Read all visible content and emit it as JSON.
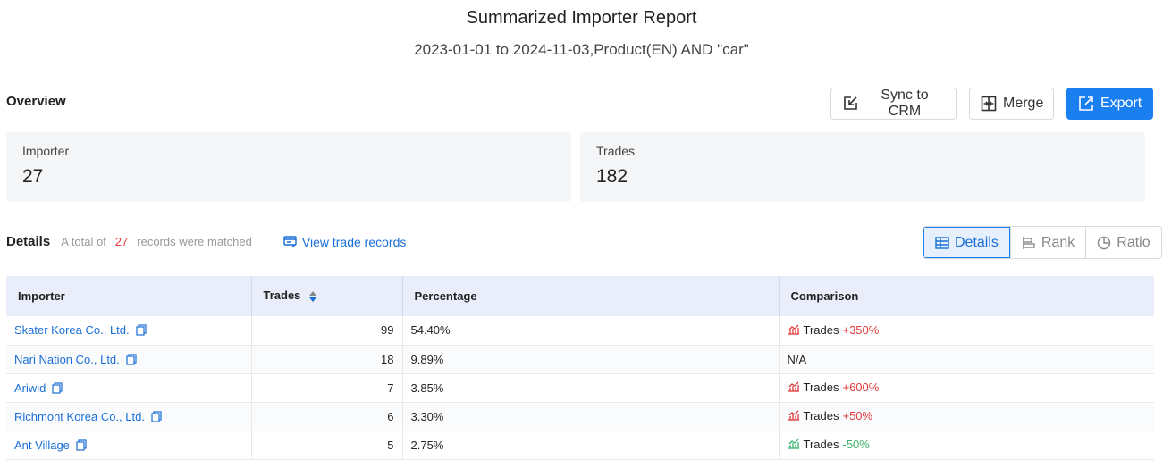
{
  "report": {
    "title": "Summarized Importer Report",
    "subtitle": "2023-01-01 to 2024-11-03,Product(EN) AND \"car\""
  },
  "overview": {
    "label": "Overview",
    "sync_label": "Sync to CRM",
    "merge_label": "Merge",
    "export_label": "Export",
    "accent_color": "#1a7ff0"
  },
  "stats": {
    "importer_label": "Importer",
    "importer_value": "27",
    "trades_label": "Trades",
    "trades_value": "182"
  },
  "details": {
    "label": "Details",
    "total_prefix": "A total of",
    "count": "27",
    "total_suffix": "records were matched",
    "view_link": "View trade records",
    "views": [
      "Details",
      "Rank",
      "Ratio"
    ],
    "active_view": "Details"
  },
  "table": {
    "headers": {
      "importer": "Importer",
      "trades": "Trades",
      "percentage": "Percentage",
      "comparison": "Comparison"
    },
    "rows": [
      {
        "importer": "Skater Korea Co., Ltd.",
        "trades": "99",
        "percentage": "54.40%",
        "cmp_label": "Trades",
        "cmp_value": "+350%",
        "trend": "up"
      },
      {
        "importer": "Nari Nation Co., Ltd.",
        "trades": "18",
        "percentage": "9.89%",
        "cmp_label": "",
        "cmp_value": "N/A",
        "trend": "none"
      },
      {
        "importer": "Ariwid",
        "trades": "7",
        "percentage": "3.85%",
        "cmp_label": "Trades",
        "cmp_value": "+600%",
        "trend": "up"
      },
      {
        "importer": "Richmont Korea Co., Ltd.",
        "trades": "6",
        "percentage": "3.30%",
        "cmp_label": "Trades",
        "cmp_value": "+50%",
        "trend": "up"
      },
      {
        "importer": "Ant Village",
        "trades": "5",
        "percentage": "2.75%",
        "cmp_label": "Trades",
        "cmp_value": "-50%",
        "trend": "down"
      }
    ]
  },
  "colors": {
    "up": "#e23b3b",
    "down": "#3bb36b",
    "link": "#1a6fd6"
  }
}
